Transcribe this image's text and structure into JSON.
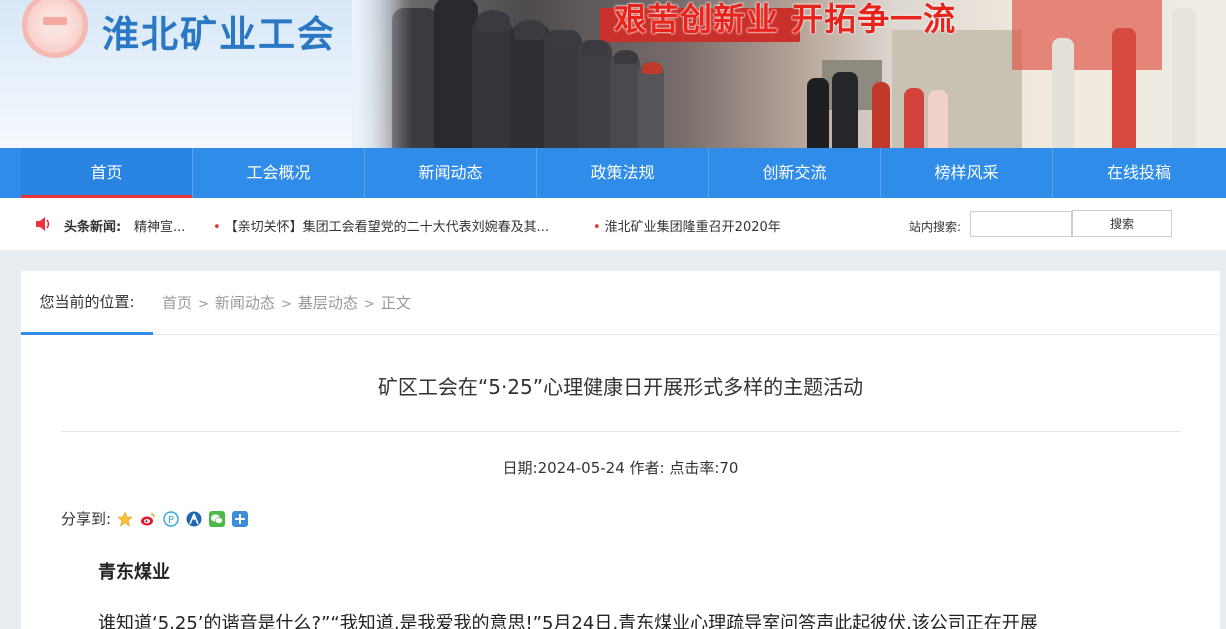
{
  "site": {
    "title": "淮北矿业工会",
    "slogan": "艰苦创新业 开拓争一流"
  },
  "nav": [
    {
      "label": "首页",
      "active": true
    },
    {
      "label": "工会概况"
    },
    {
      "label": "新闻动态"
    },
    {
      "label": "政策法规"
    },
    {
      "label": "创新交流"
    },
    {
      "label": "榜样风采"
    },
    {
      "label": "在线投稿"
    }
  ],
  "ticker": {
    "label": "头条新闻:",
    "items": [
      "精神宣...",
      "【亲切关怀】集团工会看望党的二十大代表刘婉春及其...",
      "淮北矿业集团隆重召开2020年"
    ]
  },
  "search": {
    "label": "站内搜索:",
    "placeholder": "",
    "button": "搜索"
  },
  "breadcrumb": {
    "here": "您当前的位置:",
    "items": [
      "首页",
      "新闻动态",
      "基层动态",
      "正文"
    ],
    "sep": ">"
  },
  "article": {
    "title": "矿区工会在“5·25”心理健康日开展形式多样的主题活动",
    "meta": "日期:2024-05-24 作者:  点击率:70",
    "share_label": "分享到:",
    "share_icons": [
      "qzone-icon",
      "weibo-icon",
      "pengyou-icon",
      "renren-icon",
      "wechat-icon",
      "more-icon"
    ],
    "company": "青东煤业",
    "paragraph": "谁知道‘5.25’的谐音是什么?”“我知道,是我爱我的意思!”5月24日,青东煤业心理疏导室问答声此起彼伏,该公司正在开展"
  },
  "colors": {
    "nav": "#2f8ce8",
    "accent": "#e8343a",
    "title": "#2a78c4"
  }
}
